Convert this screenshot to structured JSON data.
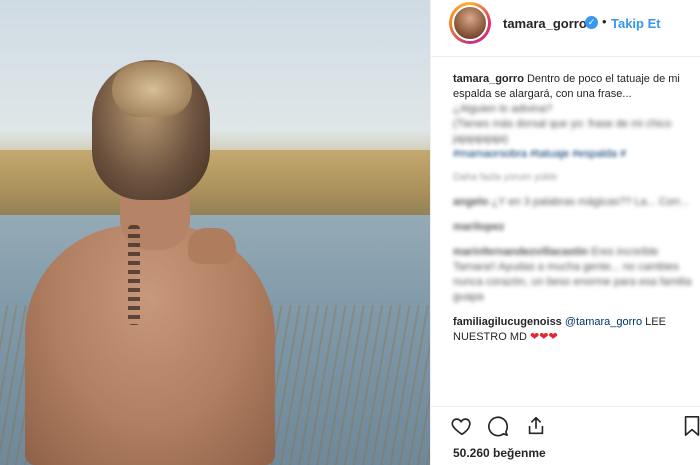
{
  "post": {
    "username": "tamara_gorro",
    "follow_label": "Takip Et",
    "dot": "•",
    "verified_glyph": "✓"
  },
  "caption": {
    "username": "tamara_gorro",
    "text_visible": "Dentro de poco el tatuaje de mi espalda se alargará, con una frase...",
    "line2_blurred": "¿Alguien lo adivina?",
    "line3_partial": "(Tienes más dorsal que yo: frase de mi chico",
    "line4_blurred": "jajajajajaja)",
    "hashtags_blurred": "#mamaorsobra #tatuaje #espalda #",
    "meta_blurred": "Daha fazla yorum yükle"
  },
  "comments": [
    {
      "username": "angelo",
      "text": "¿Y en 3 palabras mágicas?? La... Corr..."
    },
    {
      "username": "marilopez",
      "text": ""
    },
    {
      "username": "marinfernandezvillacastin",
      "text": "Eres increíble Tamara!! Ayudas a mucha gente... no cambies nunca corazón, un beso enorme para esa familia guapa"
    },
    {
      "username": "familiagilucugenoiss",
      "mention": "@tamara_gorro",
      "text": "LEE NUESTRO MD"
    }
  ],
  "comment_hearts": "❤❤❤",
  "likes": "50.260 beğenme",
  "icons": [
    "heart-icon",
    "comment-icon",
    "share-icon",
    "bookmark-icon"
  ],
  "colors": {
    "accent": "#3897f0",
    "text": "#262626",
    "heart": "#e0282e"
  }
}
